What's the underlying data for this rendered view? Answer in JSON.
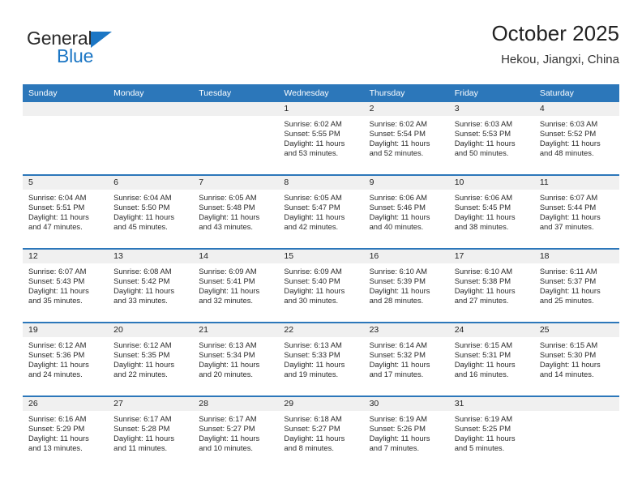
{
  "brand": {
    "name_part1": "General",
    "name_part2": "Blue",
    "logo_icon": "triangle-flag-icon",
    "accent_color": "#1b76c4"
  },
  "header": {
    "title": "October 2025",
    "location": "Hekou, Jiangxi, China"
  },
  "calendar": {
    "header_bg": "#2c77ba",
    "daynum_bg": "#f0f0f0",
    "weekday_headers": [
      "Sunday",
      "Monday",
      "Tuesday",
      "Wednesday",
      "Thursday",
      "Friday",
      "Saturday"
    ],
    "weeks": [
      [
        {
          "day": "",
          "blank": true
        },
        {
          "day": "",
          "blank": true
        },
        {
          "day": "",
          "blank": true
        },
        {
          "day": "1",
          "sunrise": "Sunrise: 6:02 AM",
          "sunset": "Sunset: 5:55 PM",
          "daylight_l1": "Daylight: 11 hours",
          "daylight_l2": "and 53 minutes."
        },
        {
          "day": "2",
          "sunrise": "Sunrise: 6:02 AM",
          "sunset": "Sunset: 5:54 PM",
          "daylight_l1": "Daylight: 11 hours",
          "daylight_l2": "and 52 minutes."
        },
        {
          "day": "3",
          "sunrise": "Sunrise: 6:03 AM",
          "sunset": "Sunset: 5:53 PM",
          "daylight_l1": "Daylight: 11 hours",
          "daylight_l2": "and 50 minutes."
        },
        {
          "day": "4",
          "sunrise": "Sunrise: 6:03 AM",
          "sunset": "Sunset: 5:52 PM",
          "daylight_l1": "Daylight: 11 hours",
          "daylight_l2": "and 48 minutes."
        }
      ],
      [
        {
          "day": "5",
          "sunrise": "Sunrise: 6:04 AM",
          "sunset": "Sunset: 5:51 PM",
          "daylight_l1": "Daylight: 11 hours",
          "daylight_l2": "and 47 minutes."
        },
        {
          "day": "6",
          "sunrise": "Sunrise: 6:04 AM",
          "sunset": "Sunset: 5:50 PM",
          "daylight_l1": "Daylight: 11 hours",
          "daylight_l2": "and 45 minutes."
        },
        {
          "day": "7",
          "sunrise": "Sunrise: 6:05 AM",
          "sunset": "Sunset: 5:48 PM",
          "daylight_l1": "Daylight: 11 hours",
          "daylight_l2": "and 43 minutes."
        },
        {
          "day": "8",
          "sunrise": "Sunrise: 6:05 AM",
          "sunset": "Sunset: 5:47 PM",
          "daylight_l1": "Daylight: 11 hours",
          "daylight_l2": "and 42 minutes."
        },
        {
          "day": "9",
          "sunrise": "Sunrise: 6:06 AM",
          "sunset": "Sunset: 5:46 PM",
          "daylight_l1": "Daylight: 11 hours",
          "daylight_l2": "and 40 minutes."
        },
        {
          "day": "10",
          "sunrise": "Sunrise: 6:06 AM",
          "sunset": "Sunset: 5:45 PM",
          "daylight_l1": "Daylight: 11 hours",
          "daylight_l2": "and 38 minutes."
        },
        {
          "day": "11",
          "sunrise": "Sunrise: 6:07 AM",
          "sunset": "Sunset: 5:44 PM",
          "daylight_l1": "Daylight: 11 hours",
          "daylight_l2": "and 37 minutes."
        }
      ],
      [
        {
          "day": "12",
          "sunrise": "Sunrise: 6:07 AM",
          "sunset": "Sunset: 5:43 PM",
          "daylight_l1": "Daylight: 11 hours",
          "daylight_l2": "and 35 minutes."
        },
        {
          "day": "13",
          "sunrise": "Sunrise: 6:08 AM",
          "sunset": "Sunset: 5:42 PM",
          "daylight_l1": "Daylight: 11 hours",
          "daylight_l2": "and 33 minutes."
        },
        {
          "day": "14",
          "sunrise": "Sunrise: 6:09 AM",
          "sunset": "Sunset: 5:41 PM",
          "daylight_l1": "Daylight: 11 hours",
          "daylight_l2": "and 32 minutes."
        },
        {
          "day": "15",
          "sunrise": "Sunrise: 6:09 AM",
          "sunset": "Sunset: 5:40 PM",
          "daylight_l1": "Daylight: 11 hours",
          "daylight_l2": "and 30 minutes."
        },
        {
          "day": "16",
          "sunrise": "Sunrise: 6:10 AM",
          "sunset": "Sunset: 5:39 PM",
          "daylight_l1": "Daylight: 11 hours",
          "daylight_l2": "and 28 minutes."
        },
        {
          "day": "17",
          "sunrise": "Sunrise: 6:10 AM",
          "sunset": "Sunset: 5:38 PM",
          "daylight_l1": "Daylight: 11 hours",
          "daylight_l2": "and 27 minutes."
        },
        {
          "day": "18",
          "sunrise": "Sunrise: 6:11 AM",
          "sunset": "Sunset: 5:37 PM",
          "daylight_l1": "Daylight: 11 hours",
          "daylight_l2": "and 25 minutes."
        }
      ],
      [
        {
          "day": "19",
          "sunrise": "Sunrise: 6:12 AM",
          "sunset": "Sunset: 5:36 PM",
          "daylight_l1": "Daylight: 11 hours",
          "daylight_l2": "and 24 minutes."
        },
        {
          "day": "20",
          "sunrise": "Sunrise: 6:12 AM",
          "sunset": "Sunset: 5:35 PM",
          "daylight_l1": "Daylight: 11 hours",
          "daylight_l2": "and 22 minutes."
        },
        {
          "day": "21",
          "sunrise": "Sunrise: 6:13 AM",
          "sunset": "Sunset: 5:34 PM",
          "daylight_l1": "Daylight: 11 hours",
          "daylight_l2": "and 20 minutes."
        },
        {
          "day": "22",
          "sunrise": "Sunrise: 6:13 AM",
          "sunset": "Sunset: 5:33 PM",
          "daylight_l1": "Daylight: 11 hours",
          "daylight_l2": "and 19 minutes."
        },
        {
          "day": "23",
          "sunrise": "Sunrise: 6:14 AM",
          "sunset": "Sunset: 5:32 PM",
          "daylight_l1": "Daylight: 11 hours",
          "daylight_l2": "and 17 minutes."
        },
        {
          "day": "24",
          "sunrise": "Sunrise: 6:15 AM",
          "sunset": "Sunset: 5:31 PM",
          "daylight_l1": "Daylight: 11 hours",
          "daylight_l2": "and 16 minutes."
        },
        {
          "day": "25",
          "sunrise": "Sunrise: 6:15 AM",
          "sunset": "Sunset: 5:30 PM",
          "daylight_l1": "Daylight: 11 hours",
          "daylight_l2": "and 14 minutes."
        }
      ],
      [
        {
          "day": "26",
          "sunrise": "Sunrise: 6:16 AM",
          "sunset": "Sunset: 5:29 PM",
          "daylight_l1": "Daylight: 11 hours",
          "daylight_l2": "and 13 minutes."
        },
        {
          "day": "27",
          "sunrise": "Sunrise: 6:17 AM",
          "sunset": "Sunset: 5:28 PM",
          "daylight_l1": "Daylight: 11 hours",
          "daylight_l2": "and 11 minutes."
        },
        {
          "day": "28",
          "sunrise": "Sunrise: 6:17 AM",
          "sunset": "Sunset: 5:27 PM",
          "daylight_l1": "Daylight: 11 hours",
          "daylight_l2": "and 10 minutes."
        },
        {
          "day": "29",
          "sunrise": "Sunrise: 6:18 AM",
          "sunset": "Sunset: 5:27 PM",
          "daylight_l1": "Daylight: 11 hours",
          "daylight_l2": "and 8 minutes."
        },
        {
          "day": "30",
          "sunrise": "Sunrise: 6:19 AM",
          "sunset": "Sunset: 5:26 PM",
          "daylight_l1": "Daylight: 11 hours",
          "daylight_l2": "and 7 minutes."
        },
        {
          "day": "31",
          "sunrise": "Sunrise: 6:19 AM",
          "sunset": "Sunset: 5:25 PM",
          "daylight_l1": "Daylight: 11 hours",
          "daylight_l2": "and 5 minutes."
        },
        {
          "day": "",
          "blank": true
        }
      ]
    ]
  }
}
